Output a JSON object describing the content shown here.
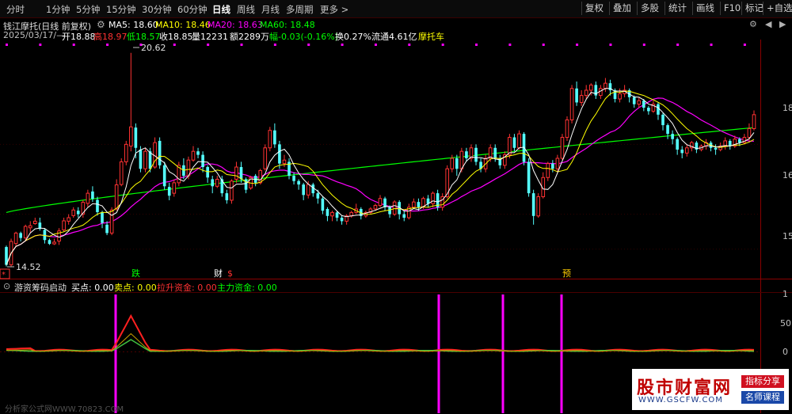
{
  "toolbar": {
    "tabs": [
      "分时",
      "1分钟",
      "5分钟",
      "15分钟",
      "30分钟",
      "60分钟",
      "日线",
      "周线",
      "月线",
      "多周期",
      "更多 >"
    ],
    "active_tab": "日线",
    "right_buttons": [
      "复权",
      "叠加",
      "多股",
      "统计",
      "画线",
      "F10",
      "标记",
      "+自选"
    ]
  },
  "stock": {
    "title": "钱江摩托(日线 前复权)",
    "ma5": "MA5: 18.60",
    "ma10": "MA10: 18.46",
    "ma20": "MA20: 18.63",
    "ma60": "MA60: 18.48",
    "date": "2025/03/17/—",
    "open": "开18.88",
    "high": "高18.97",
    "low": "低18.57",
    "close": "收18.85",
    "volume": "量12231",
    "amount": "额2289万",
    "change": "幅-0.03(-0.16%)",
    "turnover": "换0.27%",
    "float_cap": "流通4.61亿",
    "concept": "摩托车",
    "high_label": "20.62",
    "low_label": "14.52",
    "markers": {
      "m1": "跌",
      "m2": "财",
      "m3": "$",
      "m4": "预",
      "m5": "*"
    },
    "price_axis": [
      "18",
      "16",
      "15"
    ],
    "colors": {
      "up": "#ff3232",
      "down": "#54ffff",
      "ma5": "#ffffff",
      "ma10": "#ffff00",
      "ma20": "#ff00ff",
      "ma60": "#00ff00"
    }
  },
  "indicator": {
    "name": "游资筹码启动",
    "buy": "买点: 0.00",
    "sell": "卖点: 0.00",
    "pull": "拉升资金: 0.00",
    "main": "主力资金: 0.00",
    "axis": [
      "1",
      "50",
      "0"
    ]
  },
  "watermark": {
    "title": "股市财富网",
    "url": "WWW.GSCFW.COM",
    "tag1": "指标分享",
    "tag2": "名师课程",
    "footer": "分析家公式网WWW.70823.COM"
  },
  "chart_data": {
    "type": "candlestick",
    "price_range": [
      14.2,
      21.0
    ],
    "candles": [
      [
        15.06,
        14.55,
        15.1,
        14.5
      ],
      [
        14.55,
        15.22,
        15.3,
        14.5
      ],
      [
        15.16,
        15.46,
        15.5,
        15.06
      ],
      [
        15.46,
        15.32,
        15.5,
        15.22
      ],
      [
        15.32,
        15.65,
        15.7,
        15.22
      ],
      [
        15.61,
        15.67,
        15.8,
        15.46
      ],
      [
        15.73,
        15.8,
        15.9,
        15.7
      ],
      [
        15.76,
        15.58,
        15.9,
        15.53
      ],
      [
        15.55,
        15.26,
        15.6,
        15.16
      ],
      [
        15.26,
        15.15,
        15.3,
        15.12
      ],
      [
        15.15,
        15.2,
        15.3,
        15.12
      ],
      [
        15.23,
        15.52,
        15.6,
        15.12
      ],
      [
        15.55,
        15.81,
        15.9,
        15.5
      ],
      [
        15.8,
        15.9,
        16.0,
        15.7
      ],
      [
        15.96,
        16.12,
        16.2,
        15.9
      ],
      [
        16.1,
        16.0,
        16.2,
        15.9
      ],
      [
        16.0,
        16.34,
        16.4,
        15.9
      ],
      [
        16.31,
        16.6,
        16.7,
        16.2
      ],
      [
        16.65,
        16.44,
        16.8,
        16.35
      ],
      [
        16.41,
        16.06,
        16.5,
        15.96
      ],
      [
        16.06,
        15.75,
        16.1,
        15.6
      ],
      [
        15.7,
        15.46,
        15.8,
        15.4
      ],
      [
        15.46,
        16.12,
        16.2,
        15.4
      ],
      [
        16.15,
        16.84,
        17.0,
        16.1
      ],
      [
        16.85,
        17.5,
        17.6,
        16.8
      ],
      [
        17.5,
        18.0,
        18.1,
        17.4
      ],
      [
        17.95,
        18.5,
        20.62,
        17.8
      ],
      [
        18.48,
        17.9,
        18.6,
        17.6
      ],
      [
        17.85,
        17.3,
        17.95,
        17.2
      ],
      [
        17.3,
        17.8,
        17.9,
        17.2
      ],
      [
        17.8,
        17.3,
        17.9,
        17.2
      ],
      [
        17.35,
        18.05,
        18.2,
        17.3
      ],
      [
        18.1,
        17.4,
        18.2,
        17.3
      ],
      [
        17.4,
        16.8,
        17.5,
        16.7
      ],
      [
        16.78,
        16.53,
        16.9,
        16.4
      ],
      [
        16.6,
        16.9,
        17.0,
        16.5
      ],
      [
        16.9,
        17.4,
        17.5,
        16.8
      ],
      [
        17.4,
        17.1,
        17.6,
        17.0
      ],
      [
        17.1,
        17.55,
        17.65,
        17.0
      ],
      [
        17.55,
        17.8,
        17.95,
        17.5
      ],
      [
        17.8,
        17.7,
        17.9,
        17.6
      ],
      [
        17.7,
        17.35,
        17.8,
        17.2
      ],
      [
        17.35,
        17.05,
        17.4,
        16.9
      ],
      [
        17.0,
        16.8,
        17.1,
        16.6
      ],
      [
        16.8,
        17.0,
        17.1,
        16.75
      ],
      [
        17.0,
        16.6,
        17.1,
        16.5
      ],
      [
        16.6,
        16.4,
        16.7,
        16.3
      ],
      [
        16.4,
        16.95,
        17.0,
        16.3
      ],
      [
        17.0,
        17.35,
        17.5,
        16.9
      ],
      [
        17.35,
        17.0,
        17.5,
        16.9
      ],
      [
        17.0,
        16.7,
        17.05,
        16.6
      ],
      [
        16.75,
        17.05,
        17.1,
        16.7
      ],
      [
        17.1,
        16.9,
        17.15,
        16.8
      ],
      [
        16.9,
        17.25,
        17.3,
        16.85
      ],
      [
        17.3,
        17.9,
        18.0,
        17.25
      ],
      [
        17.9,
        18.4,
        18.5,
        17.8
      ],
      [
        18.4,
        18.0,
        18.6,
        17.9
      ],
      [
        18.0,
        17.45,
        18.1,
        17.3
      ],
      [
        17.45,
        17.55,
        17.7,
        17.35
      ],
      [
        17.5,
        17.1,
        17.6,
        17.0
      ],
      [
        17.1,
        16.95,
        17.2,
        16.85
      ],
      [
        16.95,
        16.85,
        17.0,
        16.7
      ],
      [
        16.85,
        16.55,
        16.9,
        16.4
      ],
      [
        16.55,
        16.85,
        16.95,
        16.45
      ],
      [
        16.85,
        16.6,
        16.9,
        16.5
      ],
      [
        16.6,
        16.45,
        16.7,
        16.3
      ],
      [
        16.45,
        16.1,
        16.5,
        16.0
      ],
      [
        16.15,
        15.95,
        16.2,
        15.8
      ],
      [
        15.95,
        16.05,
        16.1,
        15.8
      ],
      [
        16.05,
        15.9,
        16.1,
        15.8
      ],
      [
        15.9,
        15.8,
        15.95,
        15.7
      ],
      [
        15.8,
        15.95,
        16.0,
        15.7
      ],
      [
        15.95,
        16.05,
        16.1,
        15.9
      ],
      [
        16.05,
        16.15,
        16.3,
        16.0
      ],
      [
        16.15,
        15.95,
        16.2,
        15.85
      ],
      [
        15.95,
        16.05,
        16.1,
        15.9
      ],
      [
        16.05,
        16.15,
        16.2,
        16.0
      ],
      [
        16.15,
        16.25,
        16.3,
        16.1
      ],
      [
        16.25,
        16.45,
        16.55,
        16.2
      ],
      [
        16.45,
        16.2,
        16.5,
        16.1
      ],
      [
        16.2,
        16.0,
        16.25,
        15.9
      ],
      [
        16.0,
        16.35,
        16.4,
        15.95
      ],
      [
        16.35,
        16.0,
        16.4,
        15.85
      ],
      [
        16.0,
        15.9,
        16.1,
        15.8
      ],
      [
        15.9,
        16.2,
        16.3,
        15.85
      ],
      [
        16.2,
        16.35,
        16.45,
        16.15
      ],
      [
        16.35,
        16.2,
        16.45,
        16.1
      ],
      [
        16.2,
        16.45,
        16.5,
        16.15
      ],
      [
        16.45,
        16.3,
        16.55,
        16.2
      ],
      [
        16.3,
        16.6,
        16.65,
        16.2
      ],
      [
        16.6,
        16.2,
        16.7,
        16.1
      ],
      [
        16.2,
        16.5,
        16.6,
        16.1
      ],
      [
        16.5,
        17.3,
        17.4,
        16.45
      ],
      [
        17.3,
        17.6,
        17.7,
        17.2
      ],
      [
        17.6,
        17.3,
        17.7,
        17.1
      ],
      [
        17.3,
        17.8,
        17.9,
        17.2
      ],
      [
        17.8,
        17.6,
        17.9,
        17.5
      ],
      [
        17.6,
        17.9,
        18.0,
        17.5
      ],
      [
        17.9,
        17.5,
        18.0,
        17.4
      ],
      [
        17.5,
        17.3,
        17.6,
        17.2
      ],
      [
        17.3,
        17.6,
        17.7,
        17.2
      ],
      [
        17.6,
        17.9,
        18.0,
        17.5
      ],
      [
        17.9,
        17.6,
        18.0,
        17.5
      ],
      [
        17.6,
        17.4,
        17.7,
        17.3
      ],
      [
        17.4,
        17.7,
        17.8,
        17.3
      ],
      [
        17.7,
        18.2,
        18.3,
        17.6
      ],
      [
        18.2,
        17.9,
        18.3,
        17.8
      ],
      [
        17.9,
        18.3,
        18.4,
        17.85
      ],
      [
        18.3,
        17.5,
        18.35,
        17.4
      ],
      [
        17.5,
        16.6,
        17.6,
        16.5
      ],
      [
        16.6,
        15.95,
        16.7,
        15.7
      ],
      [
        15.95,
        16.5,
        16.6,
        15.9
      ],
      [
        16.5,
        17.05,
        17.2,
        16.45
      ],
      [
        17.05,
        17.45,
        17.5,
        16.95
      ],
      [
        17.45,
        17.3,
        17.55,
        17.2
      ],
      [
        17.3,
        17.6,
        17.7,
        17.2
      ],
      [
        17.6,
        18.2,
        18.3,
        17.55
      ],
      [
        18.2,
        18.7,
        18.8,
        18.1
      ],
      [
        18.7,
        19.6,
        19.7,
        18.6
      ],
      [
        19.6,
        19.2,
        19.8,
        19.1
      ],
      [
        19.2,
        19.4,
        19.55,
        19.1
      ],
      [
        19.4,
        19.55,
        19.7,
        19.3
      ],
      [
        19.55,
        19.7,
        19.75,
        19.4
      ],
      [
        19.7,
        19.4,
        19.8,
        19.3
      ],
      [
        19.4,
        19.6,
        19.7,
        19.3
      ],
      [
        19.6,
        19.75,
        19.9,
        19.5
      ],
      [
        19.75,
        19.55,
        19.85,
        19.4
      ],
      [
        19.55,
        19.3,
        19.6,
        19.2
      ],
      [
        19.3,
        19.45,
        19.6,
        19.2
      ],
      [
        19.45,
        19.55,
        19.7,
        19.35
      ],
      [
        19.55,
        19.35,
        19.6,
        19.2
      ],
      [
        19.35,
        19.15,
        19.4,
        19.05
      ],
      [
        19.15,
        19.25,
        19.35,
        19.05
      ],
      [
        19.25,
        19.05,
        19.3,
        18.95
      ],
      [
        19.05,
        18.95,
        19.1,
        18.85
      ],
      [
        18.95,
        19.15,
        19.25,
        18.9
      ],
      [
        19.15,
        18.85,
        19.2,
        18.7
      ],
      [
        18.85,
        18.55,
        18.9,
        18.4
      ],
      [
        18.55,
        18.3,
        18.6,
        18.15
      ],
      [
        18.3,
        18.15,
        18.4,
        18.0
      ],
      [
        18.15,
        17.85,
        18.2,
        17.7
      ],
      [
        17.85,
        17.75,
        17.95,
        17.6
      ],
      [
        17.75,
        17.9,
        18.0,
        17.65
      ],
      [
        17.9,
        18.05,
        18.1,
        17.8
      ],
      [
        18.05,
        17.85,
        18.1,
        17.75
      ],
      [
        17.85,
        17.95,
        18.0,
        17.8
      ],
      [
        17.95,
        18.05,
        18.15,
        17.85
      ],
      [
        18.05,
        17.9,
        18.1,
        17.8
      ],
      [
        17.9,
        17.85,
        18.0,
        17.7
      ],
      [
        17.85,
        17.95,
        18.05,
        17.8
      ],
      [
        17.95,
        18.1,
        18.2,
        17.85
      ],
      [
        18.1,
        17.95,
        18.15,
        17.85
      ],
      [
        17.95,
        18.15,
        18.25,
        17.9
      ],
      [
        18.15,
        18.05,
        18.2,
        17.95
      ],
      [
        18.05,
        18.2,
        18.3,
        18.0
      ],
      [
        18.2,
        18.45,
        18.6,
        18.1
      ],
      [
        18.45,
        18.85,
        18.97,
        18.4
      ]
    ],
    "ma60": {
      "start": 16.05,
      "end": 18.48
    }
  }
}
